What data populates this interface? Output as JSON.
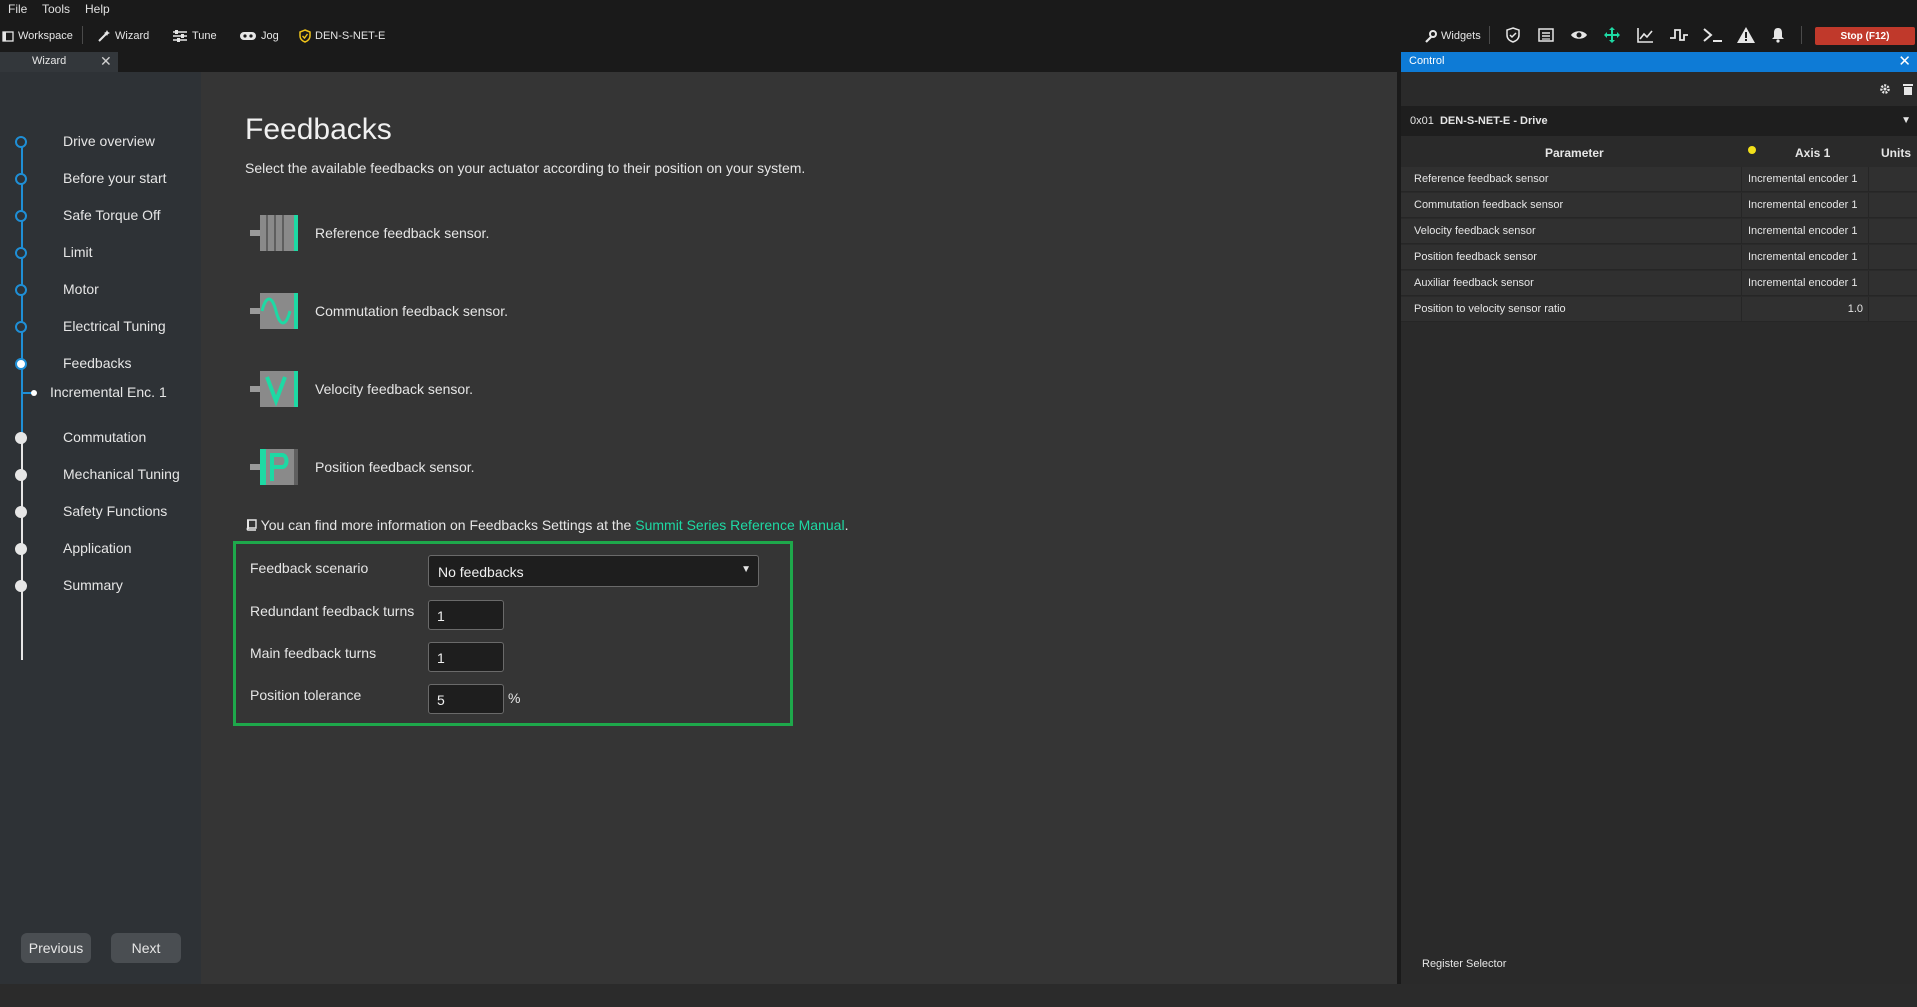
{
  "menu": {
    "items": [
      "File",
      "Tools",
      "Help"
    ]
  },
  "toolbar": {
    "workspace": "Workspace",
    "wizard": "Wizard",
    "tune": "Tune",
    "jog": "Jog",
    "device": "DEN-S-NET-E",
    "widgets": "Widgets",
    "stop": "Stop (F12)",
    "accent_color": "#1ed9a4",
    "stop_color": "#c0392b"
  },
  "tab": {
    "label": "Wizard"
  },
  "sidebar": {
    "steps": [
      "Drive overview",
      "Before your start",
      "Safe Torque Off",
      "Limit",
      "Motor",
      "Electrical Tuning",
      "Feedbacks",
      "Commutation",
      "Mechanical Tuning",
      "Safety Functions",
      "Application",
      "Summary"
    ],
    "substep": "Incremental Enc. 1",
    "previous": "Previous",
    "next": "Next"
  },
  "main": {
    "title": "Feedbacks",
    "subtitle": "Select the available feedbacks on your actuator according to their position on your system.",
    "feedbacks": [
      {
        "label": "Reference feedback sensor.",
        "icon": "reference-sensor-icon"
      },
      {
        "label": "Commutation feedback sensor.",
        "icon": "commutation-sensor-icon"
      },
      {
        "label": "Velocity feedback sensor.",
        "icon": "velocity-sensor-icon"
      },
      {
        "label": "Position feedback sensor.",
        "icon": "position-sensor-icon"
      }
    ],
    "info_prefix": "You can find more information on Feedbacks Settings at the",
    "info_link": "Summit Series Reference Manual",
    "info_suffix": ".",
    "form": {
      "scenario_label": "Feedback scenario",
      "scenario_value": "No feedbacks",
      "redundant_label": "Redundant feedback turns",
      "redundant_value": "1",
      "main_label": "Main feedback turns",
      "main_value": "1",
      "tolerance_label": "Position tolerance",
      "tolerance_value": "5",
      "tolerance_unit": "%"
    }
  },
  "control": {
    "title": "Control",
    "drive_id": "0x01",
    "drive_name": "DEN-S-NET-E - Drive",
    "columns": {
      "parameter": "Parameter",
      "axis": "Axis 1",
      "units": "Units"
    },
    "rows": [
      {
        "parameter": "Reference feedback sensor",
        "value": "Incremental encoder 1"
      },
      {
        "parameter": "Commutation feedback sensor",
        "value": "Incremental encoder 1"
      },
      {
        "parameter": "Velocity feedback sensor",
        "value": "Incremental encoder 1"
      },
      {
        "parameter": "Position feedback sensor",
        "value": "Incremental encoder 1"
      },
      {
        "parameter": "Auxiliar feedback sensor",
        "value": "Incremental encoder 1"
      },
      {
        "parameter": "Position to velocity sensor ratio",
        "value": "1.0"
      }
    ],
    "register_selector": "Register Selector"
  }
}
